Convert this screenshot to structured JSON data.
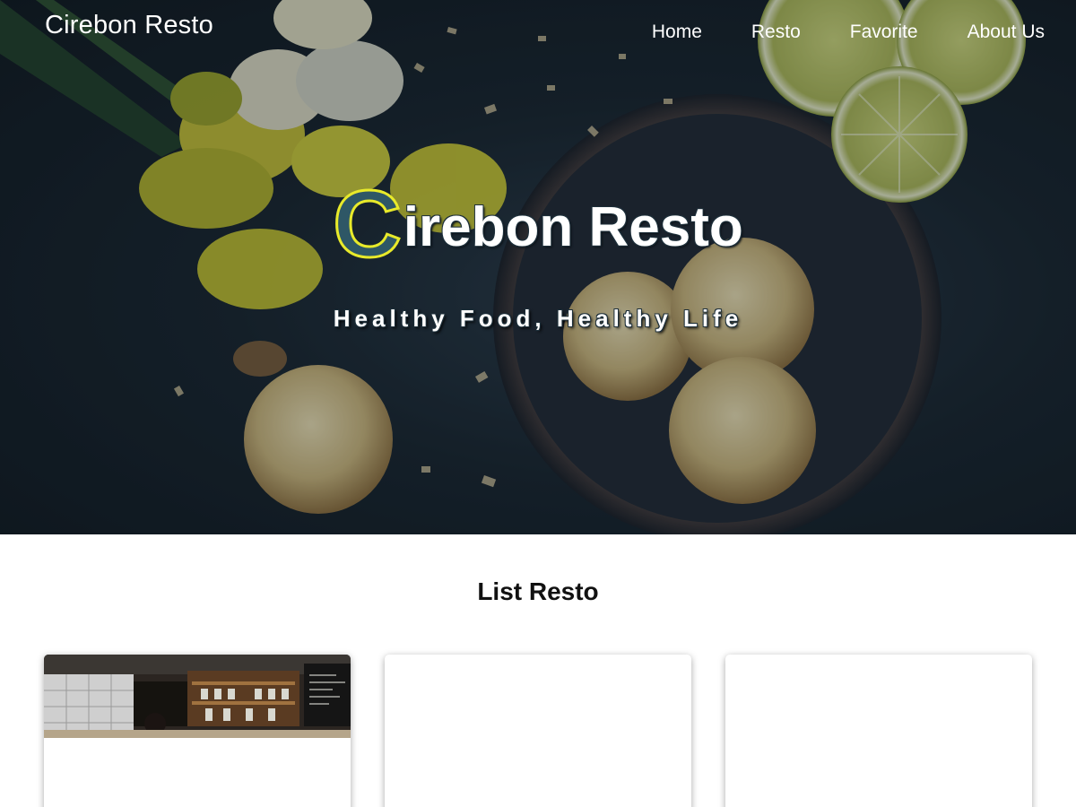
{
  "header": {
    "brand": "Cirebon Resto",
    "nav": [
      {
        "label": "Home"
      },
      {
        "label": "Resto"
      },
      {
        "label": "Favorite"
      },
      {
        "label": "About Us"
      }
    ]
  },
  "hero": {
    "title_initial": "C",
    "title_rest": "irebon Resto",
    "tagline": "Healthy Food, Healthy Life",
    "initial_fill_color": "#2e5766",
    "initial_outline_color": "#e8ea2a"
  },
  "list": {
    "heading": "List Resto"
  }
}
